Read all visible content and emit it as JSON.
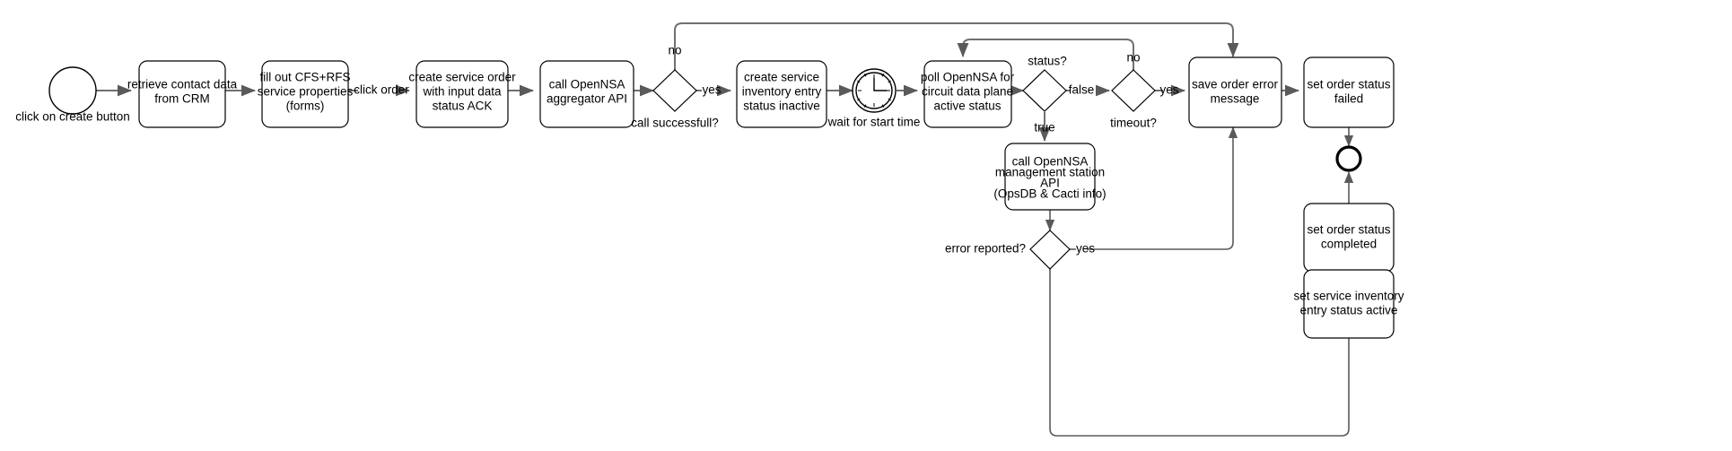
{
  "diagram": {
    "type": "bpmn-process-flowchart",
    "title": "Service order provisioning process",
    "colors": {
      "background": "#ffffff",
      "node_stroke": "#000000",
      "node_fill": "#ffffff",
      "flow_stroke": "#707070",
      "text": "#000000"
    },
    "events": [
      {
        "id": "start",
        "kind": "start-event",
        "label": "click on create button",
        "label_position": "below"
      },
      {
        "id": "end",
        "kind": "end-event",
        "label": "",
        "label_position": "none"
      }
    ],
    "timers": [
      {
        "id": "timer-start-time",
        "kind": "timer-intermediate-event",
        "label": "wait for start time",
        "label_position": "below"
      }
    ],
    "tasks": [
      {
        "id": "task-retrieve-contact",
        "lines": [
          "retrieve contact data",
          "from CRM"
        ]
      },
      {
        "id": "task-fill-forms",
        "lines": [
          "fill out CFS+RFS",
          "service properties",
          "(forms)"
        ]
      },
      {
        "id": "task-create-order",
        "lines": [
          "create service order",
          "with input data",
          "status ACK"
        ]
      },
      {
        "id": "task-call-aggregator",
        "lines": [
          "call OpenNSA",
          "aggregator API"
        ]
      },
      {
        "id": "task-create-inventory",
        "lines": [
          "create service",
          "inventory entry",
          "status inactive"
        ]
      },
      {
        "id": "task-poll-opennsa",
        "lines": [
          "poll OpenNSA for",
          "circuit data plane",
          "active status"
        ]
      },
      {
        "id": "task-call-mgmt-station",
        "lines": [
          "call OpenNSA",
          "management station",
          "API",
          "(OpsDB & Cacti info)"
        ]
      },
      {
        "id": "task-save-error",
        "lines": [
          "save order error",
          "message"
        ]
      },
      {
        "id": "task-set-status-failed",
        "lines": [
          "set order status",
          "failed"
        ]
      },
      {
        "id": "task-set-status-completed",
        "lines": [
          "set order status",
          "completed"
        ]
      },
      {
        "id": "task-set-inventory-active",
        "lines": [
          "set service inventory",
          "entry status active"
        ]
      }
    ],
    "gateways": [
      {
        "id": "gw-call-successful",
        "label": "call successfull?",
        "label_position": "below"
      },
      {
        "id": "gw-status",
        "label": "status?",
        "label_position": "above"
      },
      {
        "id": "gw-timeout",
        "label": "timeout?",
        "label_position": "below"
      },
      {
        "id": "gw-error-reported",
        "label": "error reported?",
        "label_position": "left"
      }
    ],
    "edge_labels": [
      {
        "id": "edge-click-order",
        "text": "click order"
      },
      {
        "id": "edge-call-no",
        "text": "no"
      },
      {
        "id": "edge-call-yes",
        "text": "yes"
      },
      {
        "id": "edge-status-false",
        "text": "false"
      },
      {
        "id": "edge-status-true",
        "text": "true"
      },
      {
        "id": "edge-timeout-no",
        "text": "no"
      },
      {
        "id": "edge-timeout-yes",
        "text": "yes"
      },
      {
        "id": "edge-error-yes",
        "text": "yes"
      }
    ]
  }
}
